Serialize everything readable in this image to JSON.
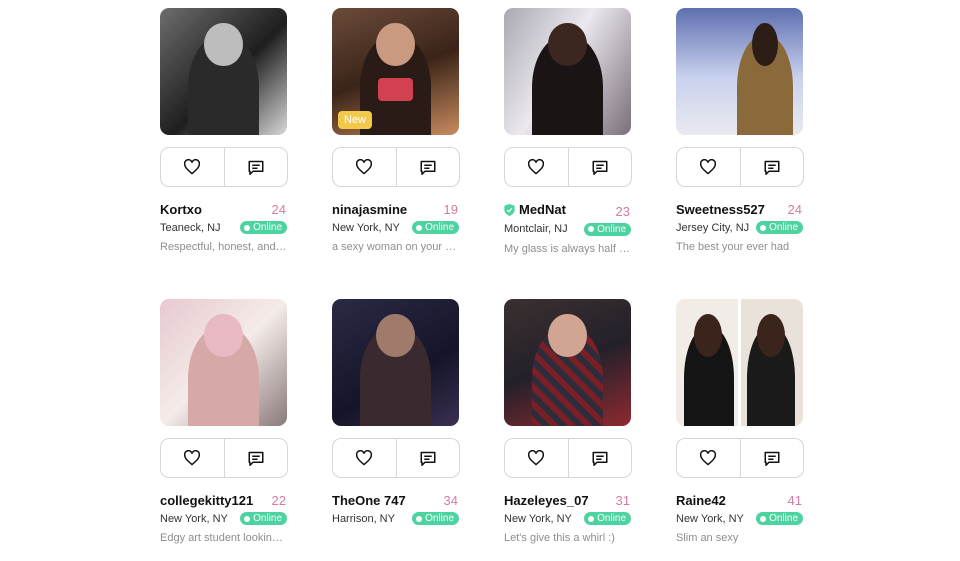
{
  "colors": {
    "online_badge": "#4cd3a0",
    "age_text": "#d87aa6",
    "new_badge": "#f2c94c",
    "verified": "#4cd3a0"
  },
  "icons": {
    "like": "heart-icon",
    "message": "chat-icon",
    "verified": "shield-check-icon"
  },
  "profiles": [
    {
      "username": "Kortxo",
      "age": "24",
      "location": "Teaneck, NJ",
      "status": "Online",
      "bio": "Respectful, honest, and …",
      "verified": false,
      "new_label": ""
    },
    {
      "username": "ninajasmine",
      "age": "19",
      "location": "New York, NY",
      "status": "Online",
      "bio": "a sexy woman on your a…",
      "verified": false,
      "new_label": "New"
    },
    {
      "username": "MedNat",
      "age": "23",
      "location": "Montclair, NJ",
      "status": "Online",
      "bio": "My glass is always half full",
      "verified": true,
      "new_label": ""
    },
    {
      "username": "Sweetness527",
      "age": "24",
      "location": "Jersey City, NJ",
      "status": "Online",
      "bio": "The best your ever had",
      "verified": false,
      "new_label": ""
    },
    {
      "username": "collegekitty121",
      "age": "22",
      "location": "New York, NY",
      "status": "Online",
      "bio": "Edgy art student looking…",
      "verified": false,
      "new_label": ""
    },
    {
      "username": "TheOne 747",
      "age": "34",
      "location": "Harrison, NY",
      "status": "Online",
      "bio": "",
      "verified": false,
      "new_label": ""
    },
    {
      "username": "Hazeleyes_07",
      "age": "31",
      "location": "New York, NY",
      "status": "Online",
      "bio": "Let's give this a whirl :)",
      "verified": false,
      "new_label": ""
    },
    {
      "username": "Raine42",
      "age": "41",
      "location": "New York, NY",
      "status": "Online",
      "bio": "Slim an sexy",
      "verified": false,
      "new_label": ""
    }
  ]
}
